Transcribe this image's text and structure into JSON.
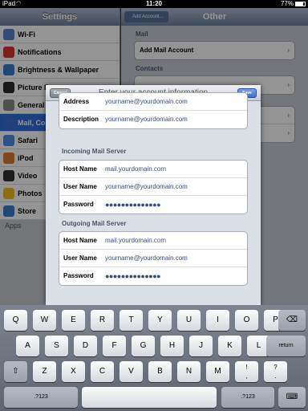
{
  "status_bar": {
    "carrier": "iPad",
    "wifi": "wifi-icon",
    "time": "11:20",
    "battery": "77%"
  },
  "master": {
    "title": "Settings",
    "items": [
      {
        "label": "Wi-Fi",
        "color": "#5a84c8"
      },
      {
        "label": "Notifications",
        "color": "#d33"
      },
      {
        "label": "Brightness & Wallpaper",
        "color": "#3a7bd5"
      },
      {
        "label": "Picture F",
        "color": "#2a2a2a"
      },
      {
        "label": "General",
        "color": "#888"
      },
      {
        "label": "Mail, Co",
        "color": "#3b6fd1"
      },
      {
        "label": "Safari",
        "color": "#4a90e2"
      },
      {
        "label": "iPod",
        "color": "#e07a2a"
      },
      {
        "label": "Video",
        "color": "#333"
      },
      {
        "label": "Photos",
        "color": "#f0c020"
      },
      {
        "label": "Store",
        "color": "#3a7bd5"
      }
    ],
    "apps_header": "Apps"
  },
  "detail": {
    "title": "Other",
    "back_label": "Add Account...",
    "mail_header": "Mail",
    "add_mail_account": "Add Mail Account",
    "contacts_header": "Contacts"
  },
  "sheet": {
    "title": "Enter your account information",
    "cancel": "Cancel",
    "save": "Save",
    "account": [
      {
        "label": "Address",
        "value": "yourname@yourdomain.com"
      },
      {
        "label": "Description",
        "value": "yourname@yourdomain.com"
      }
    ],
    "incoming_header": "Incoming Mail Server",
    "incoming": [
      {
        "label": "Host Name",
        "value": "mail.yourdomain.com"
      },
      {
        "label": "User Name",
        "value": "yourname@yourdomain.com"
      },
      {
        "label": "Password",
        "value": "●●●●●●●●●●●●●●"
      }
    ],
    "outgoing_header": "Outgoing Mail Server",
    "outgoing": [
      {
        "label": "Host Name",
        "value": "mail.yourdomain.com"
      },
      {
        "label": "User Name",
        "value": "yourname@yourdomain.com"
      },
      {
        "label": "Password",
        "value": "●●●●●●●●●●●●●●"
      }
    ]
  },
  "keyboard": {
    "row1": [
      "Q",
      "W",
      "E",
      "R",
      "T",
      "Y",
      "U",
      "I",
      "O",
      "P"
    ],
    "backspace": "⌫",
    "row2": [
      "A",
      "S",
      "D",
      "F",
      "G",
      "H",
      "J",
      "K",
      "L"
    ],
    "return": "return",
    "shift": "⇧",
    "row3": [
      "Z",
      "X",
      "C",
      "V",
      "B",
      "N",
      "M"
    ],
    "exclaim": "!\n,",
    "question": "?\n.",
    "numbers": ".?123",
    "hide": "⌨"
  }
}
